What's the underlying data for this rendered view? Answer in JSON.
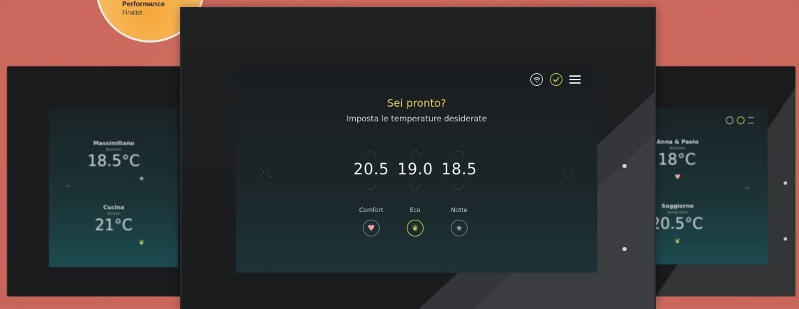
{
  "badge": {
    "line1": "Performance",
    "line2": "Finalist"
  },
  "left_device": {
    "rooms": [
      {
        "name": "Massimiliano",
        "sub": "Bedroom",
        "temp": "18.5°C",
        "icon": "star-icon"
      },
      {
        "name": "Cucina",
        "sub": "Kitchen",
        "temp": "21°C",
        "icon": "leaf-icon"
      }
    ]
  },
  "right_device": {
    "rooms": [
      {
        "name": "Anna & Paolo",
        "sub": "Bedroom",
        "temp": "18°C",
        "icon": "heart-icon"
      },
      {
        "name": "Soggiorno",
        "sub": "Living room",
        "temp": "20.5°C",
        "icon": "leaf-icon"
      }
    ]
  },
  "screen": {
    "title": "Sei pronto?",
    "subtitle": "Imposta le temperature desiderate",
    "temperatures": [
      {
        "value": "20.5",
        "mode": "Comfort",
        "icon": "heart-icon",
        "color": "#f0a096"
      },
      {
        "value": "19.0",
        "mode": "Eco",
        "icon": "leaf-icon",
        "color": "#c7d44a"
      },
      {
        "value": "18.5",
        "mode": "Notte",
        "icon": "star-icon",
        "color": "#8fb3c9"
      }
    ]
  },
  "colors": {
    "accent": "#e2c94a",
    "background": "#cd6a5e"
  }
}
